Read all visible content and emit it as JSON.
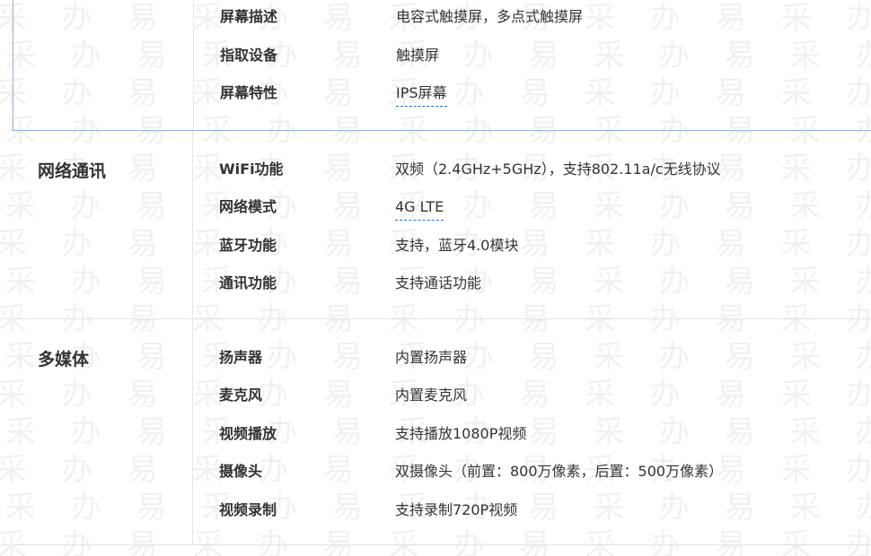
{
  "watermark": {
    "rows": [
      "采 办 易 采 办 易 采 办 易 采 办 易 采 办",
      "采 办 易 采 办 易 采 办 易 采 办 易 采 办",
      "采 办 易 采 办 易 采 办 易 采 办 易 采 办",
      "采 办 易 采 办 易 采 办 易 采 办 易 采 办",
      "采 办 易 采 办 易 采 办 易 采 办 易 采 办",
      "采 办 易 采 办 易 采 办 易 采 办 易 采 办",
      "采 办 易 采 办 易 采 办 易 采 办 易 采 办",
      "采 办 易 采 办 易 采 办 易 采 办 易 采 办",
      "采 办 易 采 办 易 采 办 易 采 办 易 采 办",
      "采 办 易 采 办 易 采 办 易 采 办 易 采 办",
      "采 办 易 采 办 易 采 办 易 采 办 易 采 办",
      "采 办 易 采 办 易 采 办 易 采 办 易 采 办",
      "采 办 易 采 办 易 采 办 易 采 办 易 采 办",
      "采 办 易 采 办 易 采 办 易 采 办 易 采 办",
      "采 办 易 采 办 易 采 办 易 采 办 易 采 办"
    ]
  },
  "screen_section": {
    "rows": [
      {
        "label": "屏幕描述",
        "value": "电容式触摸屏，多点式触摸屏"
      },
      {
        "label": "指取设备",
        "value": "触摸屏"
      },
      {
        "label": "屏幕特性",
        "value": "IPS屏幕"
      }
    ]
  },
  "network_section": {
    "title": "网络通讯",
    "rows": [
      {
        "label": "WiFi功能",
        "value": "双频（2.4GHz+5GHz），支持802.11a/c无线协议"
      },
      {
        "label": "网络模式",
        "value": "4G LTE"
      },
      {
        "label": "蓝牙功能",
        "value": "支持，蓝牙4.0模块"
      },
      {
        "label": "通讯功能",
        "value": "支持通话功能"
      }
    ]
  },
  "media_section": {
    "title": "多媒体",
    "rows": [
      {
        "label": "扬声器",
        "value": "内置扬声器"
      },
      {
        "label": "麦克风",
        "value": "内置麦克风"
      },
      {
        "label": "视频播放",
        "value": "支持播放1080P视频"
      },
      {
        "label": "摄像头",
        "value": "双摄像头（前置：800万像素，后置：500万像素）"
      },
      {
        "label": "视频录制",
        "value": "支持录制720P视频"
      }
    ]
  },
  "colors": {
    "link_dashed": "#1f6fc7",
    "section_border_blue": "#8fb4dc",
    "text": "#333333",
    "watermark": "#f1f1f1"
  }
}
